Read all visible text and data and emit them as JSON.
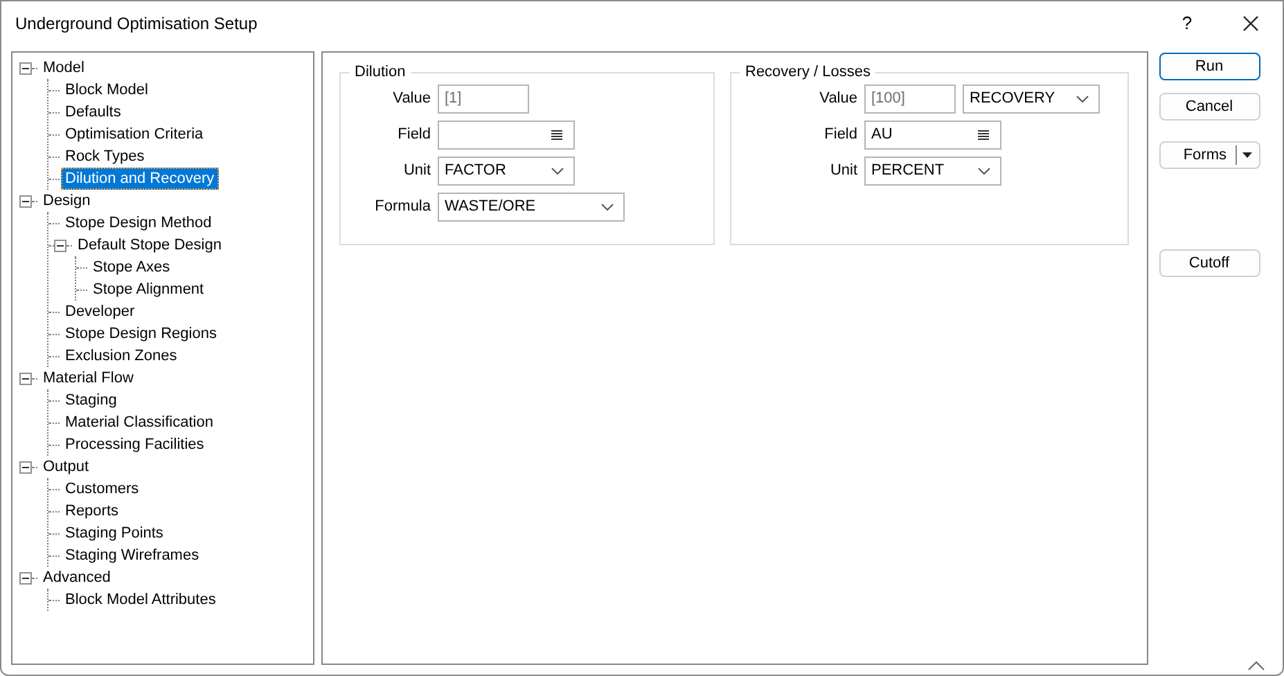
{
  "window": {
    "title": "Underground Optimisation Setup",
    "help": "?"
  },
  "tree": [
    {
      "label": "Model",
      "expanded": true,
      "selected": false,
      "children": [
        {
          "label": "Block Model",
          "selected": false
        },
        {
          "label": "Defaults",
          "selected": false
        },
        {
          "label": "Optimisation Criteria",
          "selected": false
        },
        {
          "label": "Rock Types",
          "selected": false
        },
        {
          "label": "Dilution and Recovery",
          "selected": true
        }
      ]
    },
    {
      "label": "Design",
      "expanded": true,
      "selected": false,
      "children": [
        {
          "label": "Stope Design Method",
          "selected": false
        },
        {
          "label": "Default Stope Design",
          "expanded": true,
          "selected": false,
          "children": [
            {
              "label": "Stope Axes",
              "selected": false
            },
            {
              "label": "Stope Alignment",
              "selected": false
            }
          ]
        },
        {
          "label": "Developer",
          "selected": false
        },
        {
          "label": "Stope Design Regions",
          "selected": false
        },
        {
          "label": "Exclusion Zones",
          "selected": false
        }
      ]
    },
    {
      "label": "Material Flow",
      "expanded": true,
      "selected": false,
      "children": [
        {
          "label": "Staging",
          "selected": false
        },
        {
          "label": "Material Classification",
          "selected": false
        },
        {
          "label": "Processing Facilities",
          "selected": false
        }
      ]
    },
    {
      "label": "Output",
      "expanded": true,
      "selected": false,
      "children": [
        {
          "label": "Customers",
          "selected": false
        },
        {
          "label": "Reports",
          "selected": false
        },
        {
          "label": "Staging Points",
          "selected": false
        },
        {
          "label": "Staging Wireframes",
          "selected": false
        }
      ]
    },
    {
      "label": "Advanced",
      "expanded": true,
      "selected": false,
      "children": [
        {
          "label": "Block Model Attributes",
          "selected": false
        }
      ]
    }
  ],
  "groups": [
    {
      "title": "Dilution",
      "rows": [
        {
          "label": "Value",
          "controls": [
            {
              "kind": "text",
              "placeholder": "[1]"
            }
          ]
        },
        {
          "label": "Field",
          "controls": [
            {
              "kind": "list"
            }
          ]
        },
        {
          "label": "Unit",
          "controls": [
            {
              "kind": "dropdown",
              "value": "FACTOR"
            }
          ]
        },
        {
          "label": "Formula",
          "controls": [
            {
              "kind": "dropdown",
              "value": "WASTE/ORE"
            }
          ]
        }
      ]
    },
    {
      "title": "Recovery / Losses",
      "rows": [
        {
          "label": "Value",
          "controls": [
            {
              "kind": "text",
              "placeholder": "[100]"
            },
            {
              "kind": "dropdown",
              "value": "RECOVERY"
            }
          ]
        },
        {
          "label": "Field",
          "controls": [
            {
              "kind": "list",
              "value": "AU"
            }
          ]
        },
        {
          "label": "Unit",
          "controls": [
            {
              "kind": "dropdown",
              "value": "PERCENT"
            }
          ]
        }
      ]
    }
  ],
  "buttons": [
    {
      "label": "Run",
      "kind": "plain",
      "default": true
    },
    {
      "label": "Cancel",
      "kind": "plain",
      "default": false
    },
    {
      "label": "Forms",
      "kind": "split",
      "default": false
    },
    {
      "label": "Cutoff",
      "kind": "plain",
      "default": false
    }
  ]
}
